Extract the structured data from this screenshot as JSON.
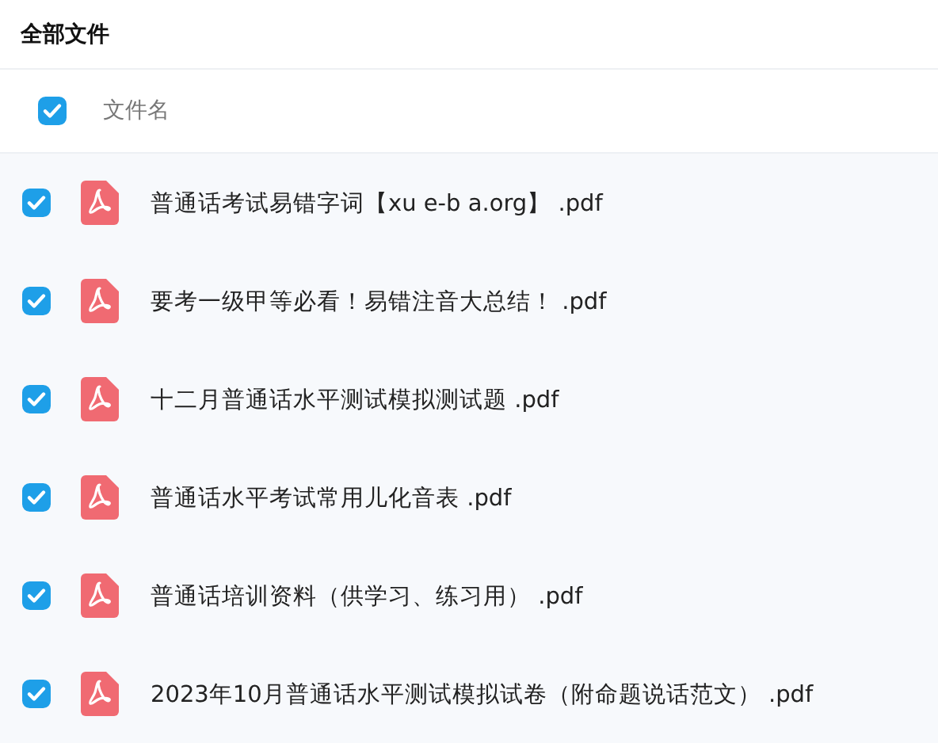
{
  "title": "全部文件",
  "header": {
    "checked": true,
    "column_1": "文件名"
  },
  "files": [
    {
      "name": "普通话考试易错字词【xu e-b a.org】 .pdf",
      "checked": true
    },
    {
      "name": "要考一级甲等必看！易错注音大总结！ .pdf",
      "checked": true
    },
    {
      "name": "十二月普通话水平测试模拟测试题 .pdf",
      "checked": true
    },
    {
      "name": "普通话水平考试常用儿化音表 .pdf",
      "checked": true
    },
    {
      "name": "普通话培训资料（供学习、练习用） .pdf",
      "checked": true
    },
    {
      "name": "2023年10月普通话水平测试模拟试卷（附命题说话范文） .pdf",
      "checked": true
    }
  ]
}
